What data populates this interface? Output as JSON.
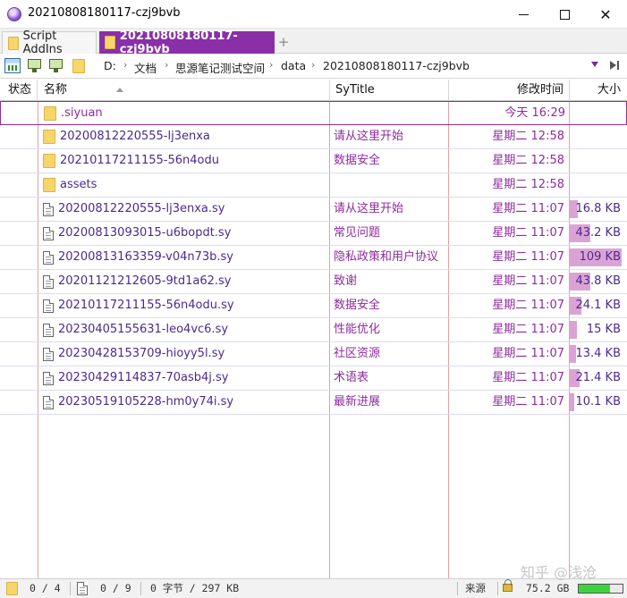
{
  "window": {
    "title": "20210808180117-czj9bvb"
  },
  "tabs": [
    {
      "label": "Script AddIns",
      "active": false
    },
    {
      "label": "20210808180117-czj9bvb",
      "active": true
    }
  ],
  "tab_add_label": "+",
  "breadcrumb": [
    "D:",
    "文档",
    "思源笔记测试空间",
    "data",
    "20210808180117-czj9bvb"
  ],
  "breadcrumb_sep": "›",
  "columns": {
    "status": "状态",
    "name": "名称",
    "sytitle": "SyTitle",
    "mtime": "修改时间",
    "size": "大小"
  },
  "rows": [
    {
      "type": "folder",
      "name": ".siyuan",
      "sytitle": "",
      "mtime": "今天  16:29",
      "size": "",
      "size_fraction": 0,
      "selected": true
    },
    {
      "type": "folder",
      "name": "20200812220555-lj3enxa",
      "sytitle": "请从这里开始",
      "mtime": "星期二  12:58",
      "size": "",
      "size_fraction": 0
    },
    {
      "type": "folder",
      "name": "20210117211155-56n4odu",
      "sytitle": "数据安全",
      "mtime": "星期二  12:58",
      "size": "",
      "size_fraction": 0
    },
    {
      "type": "folder",
      "name": "assets",
      "sytitle": "",
      "mtime": "星期二  12:58",
      "size": "",
      "size_fraction": 0
    },
    {
      "type": "file",
      "name": "20200812220555-lj3enxa.sy",
      "sytitle": "请从这里开始",
      "mtime": "星期二  11:07",
      "size": "16.8 KB",
      "size_fraction": 0.154
    },
    {
      "type": "file",
      "name": "20200813093015-u6bopdt.sy",
      "sytitle": "常见问题",
      "mtime": "星期二  11:07",
      "size": "43.2 KB",
      "size_fraction": 0.396
    },
    {
      "type": "file",
      "name": "20200813163359-v04n73b.sy",
      "sytitle": "隐私政策和用户协议",
      "mtime": "星期二  11:07",
      "size": "109 KB",
      "size_fraction": 1.0
    },
    {
      "type": "file",
      "name": "20201121212605-9td1a62.sy",
      "sytitle": "致谢",
      "mtime": "星期二  11:07",
      "size": "43.8 KB",
      "size_fraction": 0.402
    },
    {
      "type": "file",
      "name": "20210117211155-56n4odu.sy",
      "sytitle": "数据安全",
      "mtime": "星期二  11:07",
      "size": "24.1 KB",
      "size_fraction": 0.221
    },
    {
      "type": "file",
      "name": "20230405155631-leo4vc6.sy",
      "sytitle": "性能优化",
      "mtime": "星期二  11:07",
      "size": "15 KB",
      "size_fraction": 0.138
    },
    {
      "type": "file",
      "name": "20230428153709-hioyy5l.sy",
      "sytitle": "社区资源",
      "mtime": "星期二  11:07",
      "size": "13.4 KB",
      "size_fraction": 0.123
    },
    {
      "type": "file",
      "name": "20230429114837-70asb4j.sy",
      "sytitle": "术语表",
      "mtime": "星期二  11:07",
      "size": "21.4 KB",
      "size_fraction": 0.196
    },
    {
      "type": "file",
      "name": "20230519105228-hm0y74i.sy",
      "sytitle": "最新进展",
      "mtime": "星期二  11:07",
      "size": "10.1 KB",
      "size_fraction": 0.093
    }
  ],
  "statusbar": {
    "folders": "0 / 4",
    "files": "0 / 9",
    "bytes": "0 字节 / 297 KB",
    "source_label": "来源",
    "free_space": "75.2 GB",
    "disk_used_fraction": 0.72
  },
  "watermark": "知乎 @浅沧",
  "colors": {
    "accent": "#8a2fa8",
    "size_bar": "#dba3d5",
    "grid_line": "#e2a4a4",
    "text": "#4b2a8f"
  }
}
